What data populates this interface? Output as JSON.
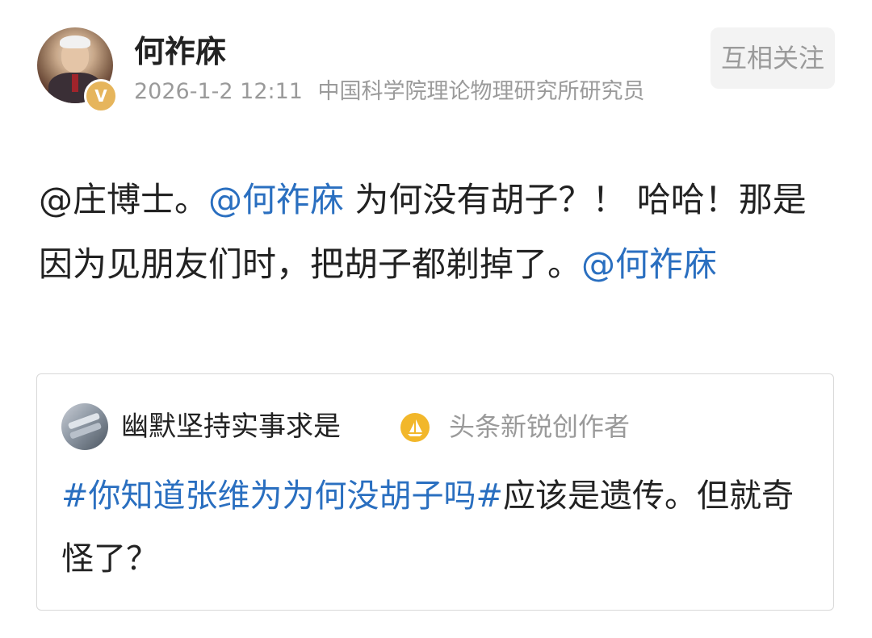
{
  "author": {
    "name": "何祚庥",
    "verified_badge": "V",
    "date": "2026-1-2 12:11",
    "title": "中国科学院理论物理研究所研究员",
    "follow_label": "互相关注"
  },
  "post": {
    "text_1": "@庄博士。",
    "mention_1": "@何祚庥",
    "text_2": " 为何没有胡子？！ 哈哈！那是因为见朋友们时，把胡子都剃掉了。",
    "mention_2": "@何祚庥"
  },
  "quoted": {
    "name": "幽默坚持实事求是",
    "badge_label": "头条新锐创作者",
    "hashtag": "#你知道张维为为何没胡子吗#",
    "text": "应该是遗传。但就奇怪了？"
  },
  "colors": {
    "link": "#2a6fc0",
    "meta_gray": "#9a9a9a",
    "badge_gold": "#e6b55c",
    "creator_badge": "#f2b72a"
  },
  "icons": {
    "verified": "verified-v-icon",
    "creator": "creator-sail-icon"
  }
}
